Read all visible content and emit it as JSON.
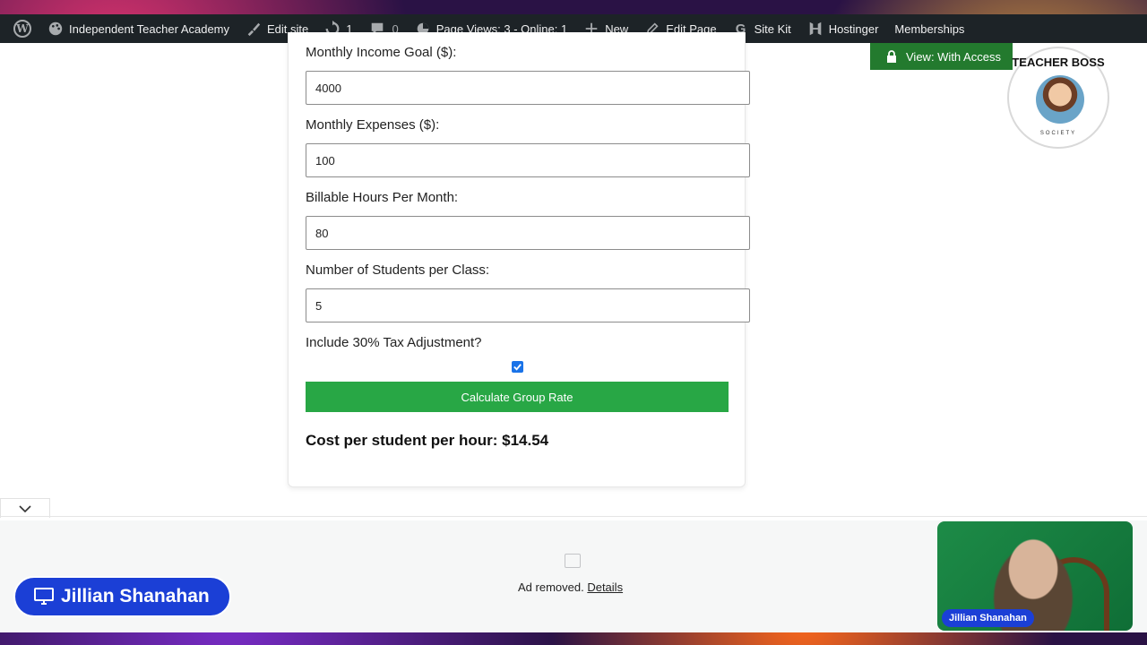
{
  "admin_bar": {
    "site_name": "Independent Teacher Academy",
    "edit_site": "Edit site",
    "updates_count": "1",
    "comments_count": "0",
    "page_views": "Page Views: 3 - Online: 1",
    "new": "New",
    "edit_page": "Edit Page",
    "site_kit": "Site Kit",
    "hostinger": "Hostinger",
    "memberships": "Memberships"
  },
  "access_badge": {
    "label": "View: With Access"
  },
  "logo": {
    "title": "TEACHER BOSS",
    "subtitle": "SOCIETY"
  },
  "form": {
    "income_label": "Monthly Income Goal ($):",
    "income_value": "4000",
    "expenses_label": "Monthly Expenses ($):",
    "expenses_value": "100",
    "hours_label": "Billable Hours Per Month:",
    "hours_value": "80",
    "students_label": "Number of Students per Class:",
    "students_value": "5",
    "tax_label": "Include 30% Tax Adjustment?",
    "tax_checked": true,
    "button_label": "Calculate Group Rate",
    "result": "Cost per student per hour: $14.54"
  },
  "ad": {
    "text": "Ad removed.",
    "details": "Details"
  },
  "presenter": {
    "name": "Jillian Shanahan",
    "webcam_label": "Jillian Shanahan"
  },
  "colors": {
    "admin_bar": "#1d2327",
    "button": "#28a745",
    "access_badge": "#237a2e",
    "name_pill": "#1b3fd6"
  }
}
